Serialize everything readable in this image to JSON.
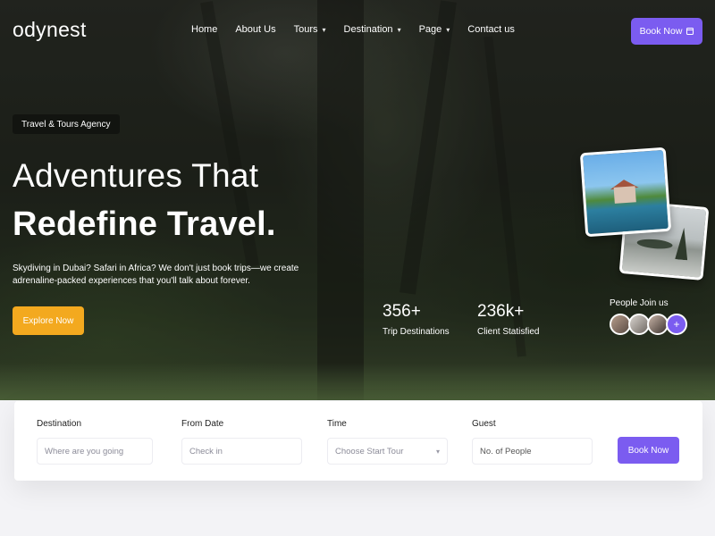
{
  "brand": {
    "logo": "odynest"
  },
  "nav": {
    "items": [
      {
        "label": "Home",
        "has_dropdown": false
      },
      {
        "label": "About Us",
        "has_dropdown": false
      },
      {
        "label": "Tours",
        "has_dropdown": true
      },
      {
        "label": "Destination",
        "has_dropdown": true
      },
      {
        "label": "Page",
        "has_dropdown": true
      },
      {
        "label": "Contact us",
        "has_dropdown": false
      }
    ],
    "book_label": "Book Now"
  },
  "hero": {
    "tagline": "Travel & Tours Agency",
    "title_line1": "Adventures That",
    "title_line2": "Redefine Travel.",
    "description": "Skydiving in Dubai? Safari in Africa? We don't just book trips—we create adrenaline-packed experiences that you'll talk about forever.",
    "cta_label": "Explore Now",
    "stats": [
      {
        "number": "356+",
        "label": "Trip Destinations"
      },
      {
        "number": "236k+",
        "label": "Client Statisfied"
      }
    ],
    "people_label": "People Join us",
    "avatar_more": "+"
  },
  "search": {
    "fields": [
      {
        "label": "Destination",
        "placeholder": "Where are you going"
      },
      {
        "label": "From Date",
        "placeholder": "Check in"
      },
      {
        "label": "Time",
        "placeholder": "Choose Start Tour"
      },
      {
        "label": "Guest",
        "placeholder": "No. of People"
      }
    ],
    "submit_label": "Book Now"
  },
  "colors": {
    "accent": "#7b5cf0",
    "cta": "#f3a91f"
  }
}
